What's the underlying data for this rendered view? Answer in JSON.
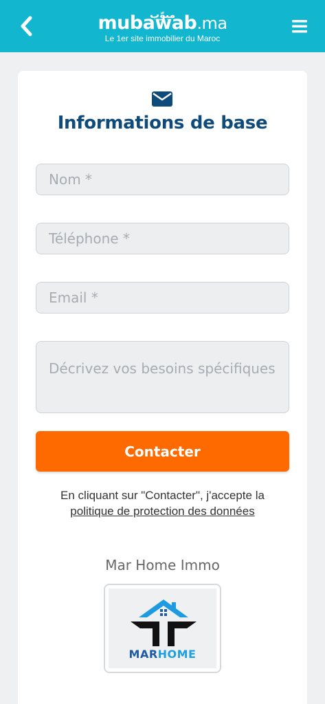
{
  "header": {
    "logo_arabic": "مبوّب",
    "logo_main": "mubawab",
    "logo_tld": ".ma",
    "tagline": "Le 1er site immobilier du Maroc"
  },
  "form": {
    "title": "Informations de base",
    "name_placeholder": "Nom *",
    "phone_placeholder": "Téléphone *",
    "email_placeholder": "Email *",
    "needs_placeholder": "Décrivez vos besoins spécifiques",
    "submit_label": "Contacter"
  },
  "legal": {
    "text": "En cliquant sur \"Contacter\", j'accepte la",
    "link": "politique de protection des données"
  },
  "agency": {
    "name": "Mar Home Immo",
    "logo_text_mar": "MAR",
    "logo_text_home": "HOME"
  },
  "colors": {
    "header": "#12b6cf",
    "title": "#0e4a7a",
    "button": "#ff6a00"
  }
}
